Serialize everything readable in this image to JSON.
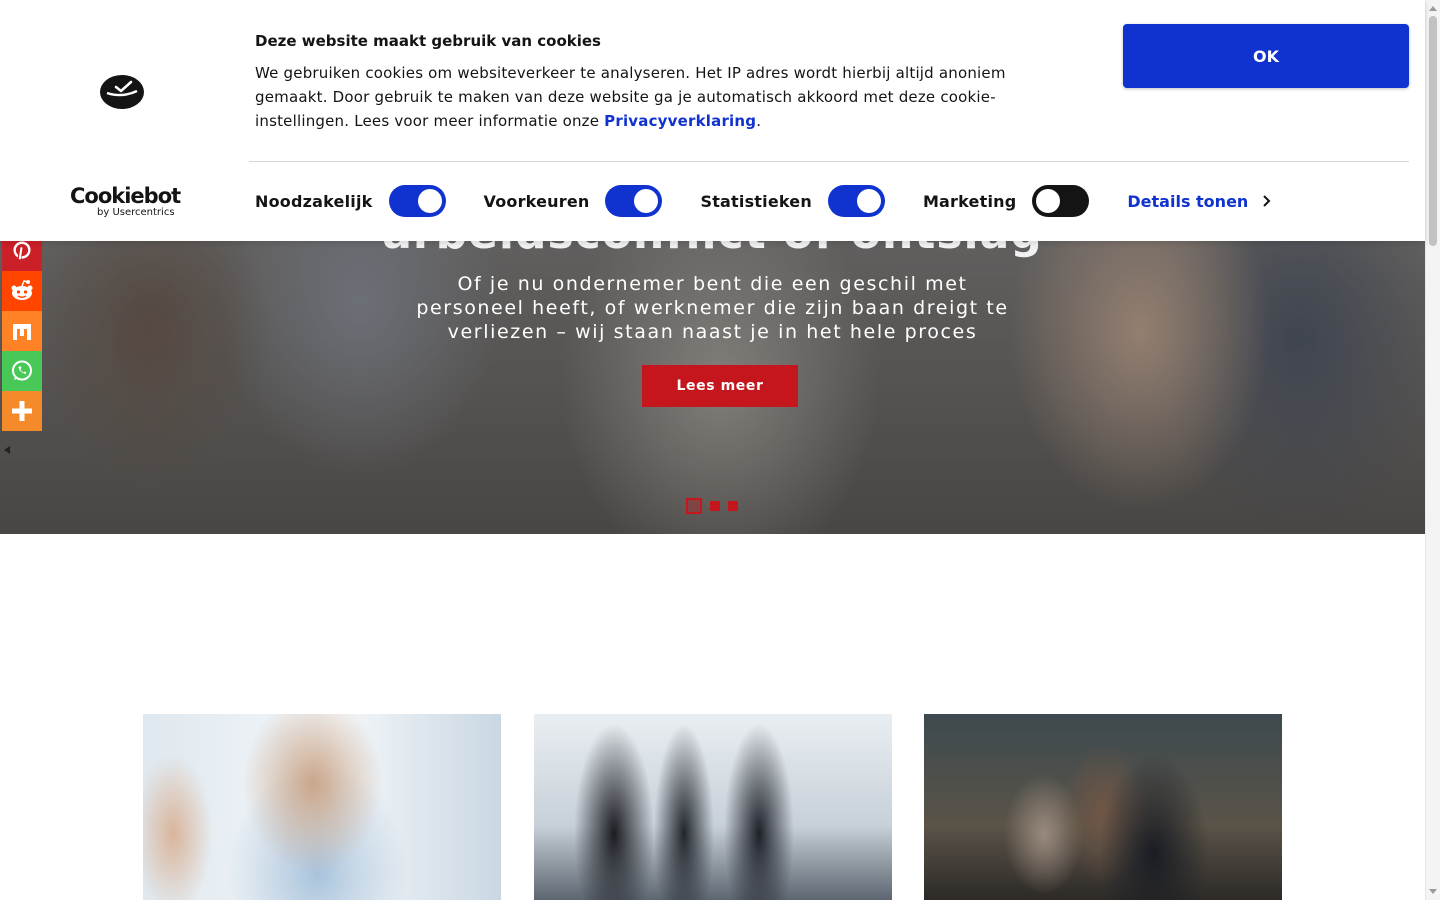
{
  "cookie_banner": {
    "title": "Deze website maakt gebruik van cookies",
    "text": "We gebruiken cookies om websiteverkeer te analyseren. Het IP adres wordt hierbij altijd anoniem gemaakt. Door gebruik te maken van deze website ga je automatisch akkoord met deze cookie-instellingen. Lees voor meer informatie onze ",
    "privacy_link": "Privacyverklaring",
    "text_end": ".",
    "ok_label": "OK",
    "brand_name": "Cookiebot",
    "brand_sub": "by Usercentrics",
    "toggles": [
      {
        "label": "Noodzakelijk",
        "state": "on"
      },
      {
        "label": "Voorkeuren",
        "state": "on"
      },
      {
        "label": "Statistieken",
        "state": "on"
      },
      {
        "label": "Marketing",
        "state": "off"
      }
    ],
    "details_label": "Details tonen",
    "accent_color": "#1032cf"
  },
  "hero": {
    "heading": "arbeidsconflict of ontslag",
    "subtitle": "Of je nu ondernemer bent die een geschil met personeel heeft, of werknemer die zijn baan dreigt te verliezen – wij staan naast je in het hele proces",
    "button_label": "Lees meer",
    "button_color": "#c4161c",
    "slide_count": 3,
    "active_slide": 1
  },
  "share_bar": {
    "items": [
      {
        "name": "pinterest",
        "icon": "pinterest-icon",
        "color": "#cb2027"
      },
      {
        "name": "reddit",
        "icon": "reddit-icon",
        "color": "#ff4500"
      },
      {
        "name": "mix",
        "icon": "mix-icon",
        "color": "#ff8226"
      },
      {
        "name": "whatsapp",
        "icon": "whatsapp-icon",
        "color": "#48c857"
      },
      {
        "name": "more",
        "icon": "plus-icon",
        "color": "#f58a2b"
      }
    ]
  },
  "cards": [
    {
      "image": "business-meeting-photo"
    },
    {
      "image": "handshake-photo"
    },
    {
      "image": "cafe-meeting-photo"
    }
  ]
}
